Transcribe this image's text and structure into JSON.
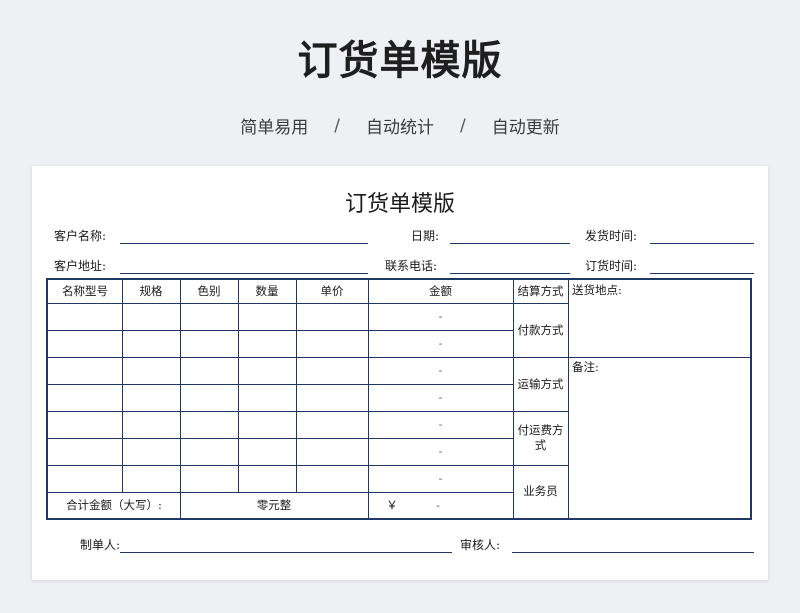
{
  "hero": {
    "title": "订货单模版",
    "features": [
      "简单易用",
      "自动统计",
      "自动更新"
    ],
    "separator": "/"
  },
  "form": {
    "title": "订货单模版",
    "fields": {
      "customer_name": "客户名称:",
      "date": "日期:",
      "ship_time": "发货时间:",
      "customer_address": "客户地址:",
      "phone": "联系电话:",
      "order_time": "订货时间:"
    },
    "table": {
      "headers": [
        "名称型号",
        "规格",
        "色别",
        "数量",
        "单价",
        "金额",
        "结算方式"
      ],
      "amount_placeholder": "-",
      "side_labels": [
        "付款方式",
        "运输方式",
        "付运费方式",
        "业务员"
      ],
      "delivery_label": "送货地点:",
      "remarks_label": "备注:",
      "total_label": "合计金额（大写）:",
      "total_words": "零元整",
      "currency_symbol": "￥",
      "total_amount": "-"
    },
    "footer": {
      "maker": "制单人:",
      "reviewer": "审核人:"
    }
  },
  "colors": {
    "border": "#1f3864",
    "background": "#eef0f3"
  }
}
